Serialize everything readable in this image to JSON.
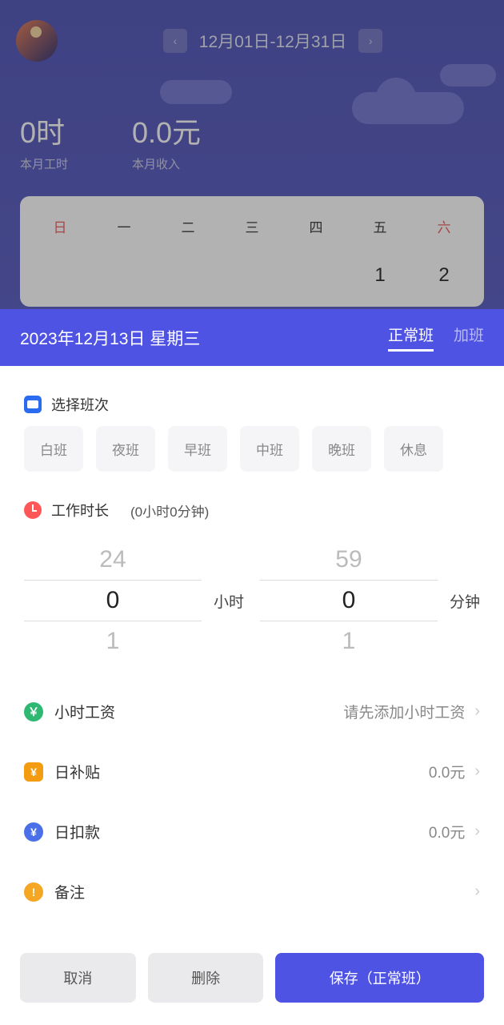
{
  "header": {
    "date_range": "12月01日-12月31日"
  },
  "stats": {
    "hours_value": "0时",
    "hours_label": "本月工时",
    "income_value": "0.0元",
    "income_label": "本月收入"
  },
  "weekdays": [
    "日",
    "一",
    "二",
    "三",
    "四",
    "五",
    "六"
  ],
  "cal_days": [
    "",
    "",
    "",
    "",
    "",
    "1",
    "2"
  ],
  "sheet": {
    "date": "2023年12月13日 星期三",
    "tab_normal": "正常班",
    "tab_overtime": "加班"
  },
  "shift": {
    "section_label": "选择班次",
    "options": [
      "白班",
      "夜班",
      "早班",
      "中班",
      "晚班",
      "休息"
    ]
  },
  "duration": {
    "section_label": "工作时长",
    "summary": "(0小时0分钟)",
    "hour_prev": "24",
    "hour_sel": "0",
    "hour_next": "1",
    "hour_unit": "小时",
    "min_prev": "59",
    "min_sel": "0",
    "min_next": "1",
    "min_unit": "分钟"
  },
  "rows": {
    "wage_label": "小时工资",
    "wage_value": "请先添加小时工资",
    "allowance_label": "日补贴",
    "allowance_value": "0.0元",
    "deduction_label": "日扣款",
    "deduction_value": "0.0元",
    "note_label": "备注"
  },
  "footer": {
    "cancel": "取消",
    "delete": "删除",
    "save": "保存（正常班）"
  }
}
